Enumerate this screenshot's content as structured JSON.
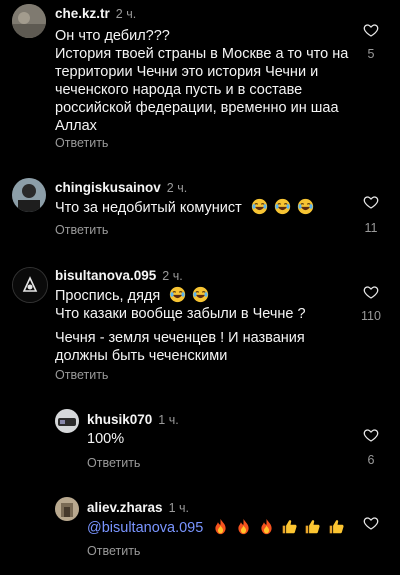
{
  "comments": [
    {
      "username": "che.kz.tr",
      "time": "2 ч.",
      "lines": [
        "Он что дебил???",
        "История твоей страны в Москве а то что на территории Чечни это история Чечни и чеченского народа пусть и в составе российской федерации, временно ин шаа Аллах"
      ],
      "reply_label": "Ответить",
      "likes": "5"
    },
    {
      "username": "chingiskusainov",
      "time": "2 ч.",
      "text": "Что за недобитый комунист",
      "emoji": [
        "laugh-cry-emoji",
        "laugh-cry-emoji",
        "laugh-cry-emoji"
      ],
      "reply_label": "Ответить",
      "likes": "11"
    },
    {
      "username": "bisultanova.095",
      "time": "2 ч.",
      "line1": "Проспись, дядя",
      "emoji": [
        "laugh-cry-emoji",
        "laugh-cry-emoji"
      ],
      "line2": "Что казаки вообще забыли в Чечне ?",
      "line3": "Чечня - земля чеченцев ! И названия должны быть чеченскими",
      "reply_label": "Ответить",
      "likes": "110"
    },
    {
      "username": "khusik070",
      "time": "1 ч.",
      "text": "100%",
      "reply_label": "Ответить",
      "likes": "6"
    },
    {
      "username": "aliev.zharas",
      "time": "1 ч.",
      "mention": "@bisultanova.095",
      "emoji": [
        "fire-emoji",
        "fire-emoji",
        "fire-emoji",
        "thumbs-up-emoji",
        "thumbs-up-emoji",
        "thumbs-up-emoji"
      ],
      "reply_label": "Ответить"
    }
  ],
  "colors": {
    "background": "#000000",
    "text": "#f5f5f5",
    "muted": "#9a9a9a",
    "mention": "#7a95ff"
  }
}
